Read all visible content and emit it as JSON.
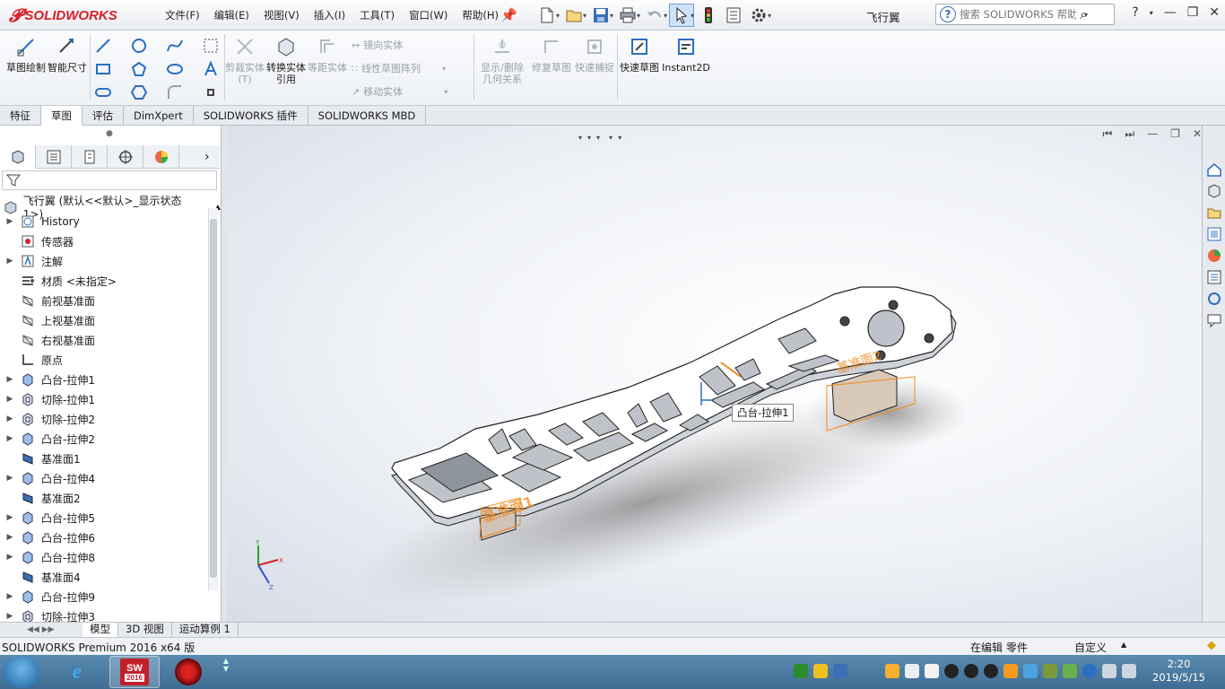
{
  "app": {
    "brand": "SOLIDWORKS",
    "document_title": "飞行翼",
    "menus": [
      "文件(F)",
      "编辑(E)",
      "视图(V)",
      "插入(I)",
      "工具(T)",
      "窗口(W)",
      "帮助(H)"
    ],
    "help_search_placeholder": "搜索 SOLIDWORKS 帮助",
    "help_label": "?"
  },
  "ribbon": {
    "sketch": "草图绘制",
    "smart_dim": "智能尺寸",
    "trim": "剪裁实体(T)",
    "convert": "转换实体引用",
    "offset": "等距实体",
    "mirror": "镜向实体",
    "linear_pattern": "线性草图阵列",
    "move": "移动实体",
    "relations": "显示/删除几何关系",
    "repair": "修复草图",
    "snap": "快速捕捉",
    "rapid_sketch": "快速草图",
    "instant2d": "Instant2D"
  },
  "command_tabs": [
    {
      "label": "特征",
      "active": false
    },
    {
      "label": "草图",
      "active": true
    },
    {
      "label": "评估",
      "active": false
    },
    {
      "label": "DimXpert",
      "active": false
    },
    {
      "label": "SOLIDWORKS 插件",
      "active": false
    },
    {
      "label": "SOLIDWORKS MBD",
      "active": false
    }
  ],
  "feature_tree": {
    "root": "飞行翼  (默认<<默认>_显示状态 1>)",
    "items": [
      {
        "label": "History",
        "icon": "history-icon",
        "expand": true
      },
      {
        "label": "传感器",
        "icon": "sensor-icon",
        "expand": false
      },
      {
        "label": "注解",
        "icon": "annotation-icon",
        "expand": true
      },
      {
        "label": "材质 <未指定>",
        "icon": "material-icon",
        "expand": false
      },
      {
        "label": "前视基准面",
        "icon": "plane-icon",
        "expand": false
      },
      {
        "label": "上视基准面",
        "icon": "plane-icon",
        "expand": false
      },
      {
        "label": "右视基准面",
        "icon": "plane-icon",
        "expand": false
      },
      {
        "label": "原点",
        "icon": "origin-icon",
        "expand": false
      },
      {
        "label": "凸台-拉伸1",
        "icon": "boss-extrude-icon",
        "expand": true
      },
      {
        "label": "切除-拉伸1",
        "icon": "cut-extrude-icon",
        "expand": true
      },
      {
        "label": "切除-拉伸2",
        "icon": "cut-extrude-icon",
        "expand": true
      },
      {
        "label": "凸台-拉伸2",
        "icon": "boss-extrude-icon",
        "expand": true
      },
      {
        "label": "基准面1",
        "icon": "datum-plane-icon",
        "expand": false
      },
      {
        "label": "凸台-拉伸4",
        "icon": "boss-extrude-icon",
        "expand": true
      },
      {
        "label": "基准面2",
        "icon": "datum-plane-icon",
        "expand": false
      },
      {
        "label": "凸台-拉伸5",
        "icon": "boss-extrude-icon",
        "expand": true
      },
      {
        "label": "凸台-拉伸6",
        "icon": "boss-extrude-icon",
        "expand": true
      },
      {
        "label": "凸台-拉伸8",
        "icon": "boss-extrude-icon",
        "expand": true
      },
      {
        "label": "基准面4",
        "icon": "datum-plane-icon",
        "expand": false
      },
      {
        "label": "凸台-拉伸9",
        "icon": "boss-extrude-icon",
        "expand": true
      },
      {
        "label": "切除-拉伸3",
        "icon": "cut-extrude-icon",
        "expand": true
      }
    ]
  },
  "viewport": {
    "callout": "凸台-拉伸1",
    "plane_label_1": "基准面1",
    "plane_label_2": "基准面2",
    "axis_x": "X",
    "axis_y": "Y",
    "axis_z": "Z"
  },
  "bottom_tabs": [
    "模型",
    "3D 视图",
    "运动算例 1"
  ],
  "status": {
    "product": "SOLIDWORKS Premium 2016 x64 版",
    "editing": "在编辑 零件",
    "units": "自定义"
  },
  "taskbar": {
    "sw_badge": "2016",
    "time": "2:20",
    "date": "2019/5/15"
  },
  "colors": {
    "accent": "#d8202a",
    "edge_orange": "#f08a1c",
    "selection_blue": "#2a6fc2"
  }
}
